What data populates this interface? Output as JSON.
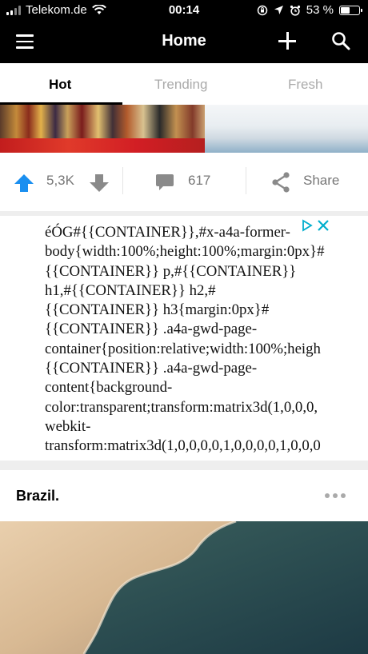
{
  "status_bar": {
    "carrier": "Telekom.de",
    "time": "00:14",
    "battery_percent_text": "53 %",
    "battery_level": 0.53
  },
  "nav": {
    "title": "Home",
    "menu_icon": "hamburger-menu-icon",
    "add_icon": "plus-icon",
    "search_icon": "search-icon"
  },
  "tabs": [
    {
      "label": "Hot",
      "active": true
    },
    {
      "label": "Trending",
      "active": false
    },
    {
      "label": "Fresh",
      "active": false
    }
  ],
  "post1": {
    "upvotes": "5,3K",
    "comments": "617",
    "share_label": "Share"
  },
  "ad": {
    "text": "éÓG#{{CONTAINER}},#x-a4a-former-\nbody{width:100%;height:100%;margin:0px}#\n{{CONTAINER}} p,#{{CONTAINER}}\nh1,#{{CONTAINER}} h2,#\n{{CONTAINER}} h3{margin:0px}#\n{{CONTAINER}} .a4a-gwd-page-\ncontainer{position:relative;width:100%;heigh\n{{CONTAINER}} .a4a-gwd-page-\ncontent{background-\ncolor:transparent;transform:matrix3d(1,0,0,0,\nwebkit-\ntransform:matrix3d(1,0,0,0,0,1,0,0,0,0,1,0,0,0",
    "accent_color": "#00aecd"
  },
  "post2": {
    "title": "Brazil."
  }
}
